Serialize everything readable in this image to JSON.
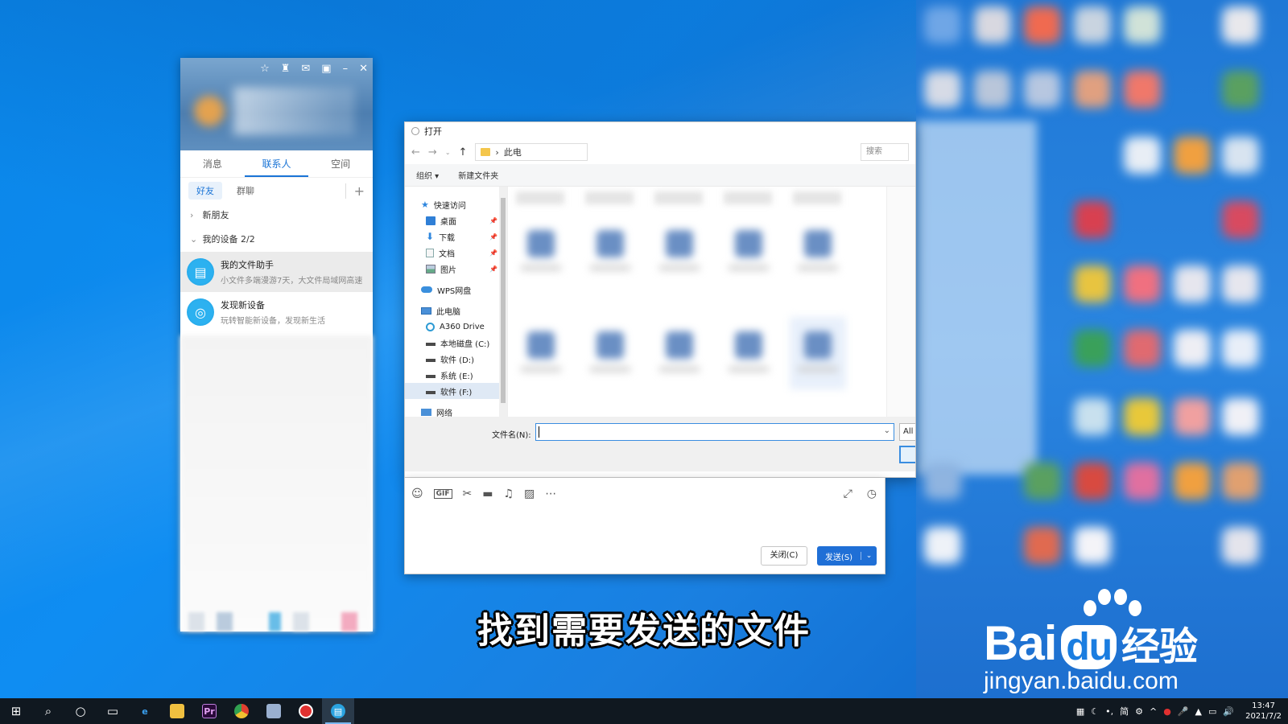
{
  "qq": {
    "tabs": [
      "消息",
      "联系人",
      "空间"
    ],
    "subtabs": [
      "好友",
      "群聊"
    ],
    "groups": {
      "new_friends": "新朋友",
      "my_devices": "我的设备 2/2"
    },
    "items": [
      {
        "title": "我的文件助手",
        "subtitle": "小文件多端漫游7天，大文件局域网高速"
      },
      {
        "title": "发现新设备",
        "subtitle": "玩转智能新设备，发现新生活"
      }
    ]
  },
  "dialog": {
    "title": "打开",
    "address": "此电",
    "search_placeholder": "搜索",
    "cmd_organize": "组织 ▾",
    "cmd_new_folder": "新建文件夹",
    "sidebar": [
      {
        "label": "快速访问",
        "icon": "star-icon"
      },
      {
        "label": "桌面",
        "icon": "desktop-icon"
      },
      {
        "label": "下载",
        "icon": "download-icon"
      },
      {
        "label": "文档",
        "icon": "document-icon"
      },
      {
        "label": "图片",
        "icon": "pictures-icon"
      },
      {
        "label": "WPS网盘",
        "icon": "cloud-icon"
      },
      {
        "label": "此电脑",
        "icon": "pc-icon"
      },
      {
        "label": "A360 Drive",
        "icon": "a360-icon"
      },
      {
        "label": "本地磁盘 (C:)",
        "icon": "drive-icon"
      },
      {
        "label": "软件 (D:)",
        "icon": "drive-icon"
      },
      {
        "label": "系统 (E:)",
        "icon": "drive-icon"
      },
      {
        "label": "软件 (F:)",
        "icon": "drive-icon"
      },
      {
        "label": "网络",
        "icon": "network-icon"
      }
    ],
    "filename_label": "文件名(N):",
    "filename_value": "",
    "filetype": "All"
  },
  "chat": {
    "close_label": "关闭(C)",
    "send_label": "发送(S)",
    "gif_label": "GIF"
  },
  "subtitle": "找到需要发送的文件",
  "watermark": {
    "brand_prefix": "Bai",
    "brand_du": "du",
    "brand_suffix": "经验",
    "url": "jingyan.baidu.com"
  },
  "taskbar": {
    "time": "13:47",
    "date": "2021/7/2",
    "ime": "简"
  },
  "colors": {
    "accent": "#1a74d6",
    "desktop": "#0f8df2",
    "send_button": "#1f6fd6"
  }
}
